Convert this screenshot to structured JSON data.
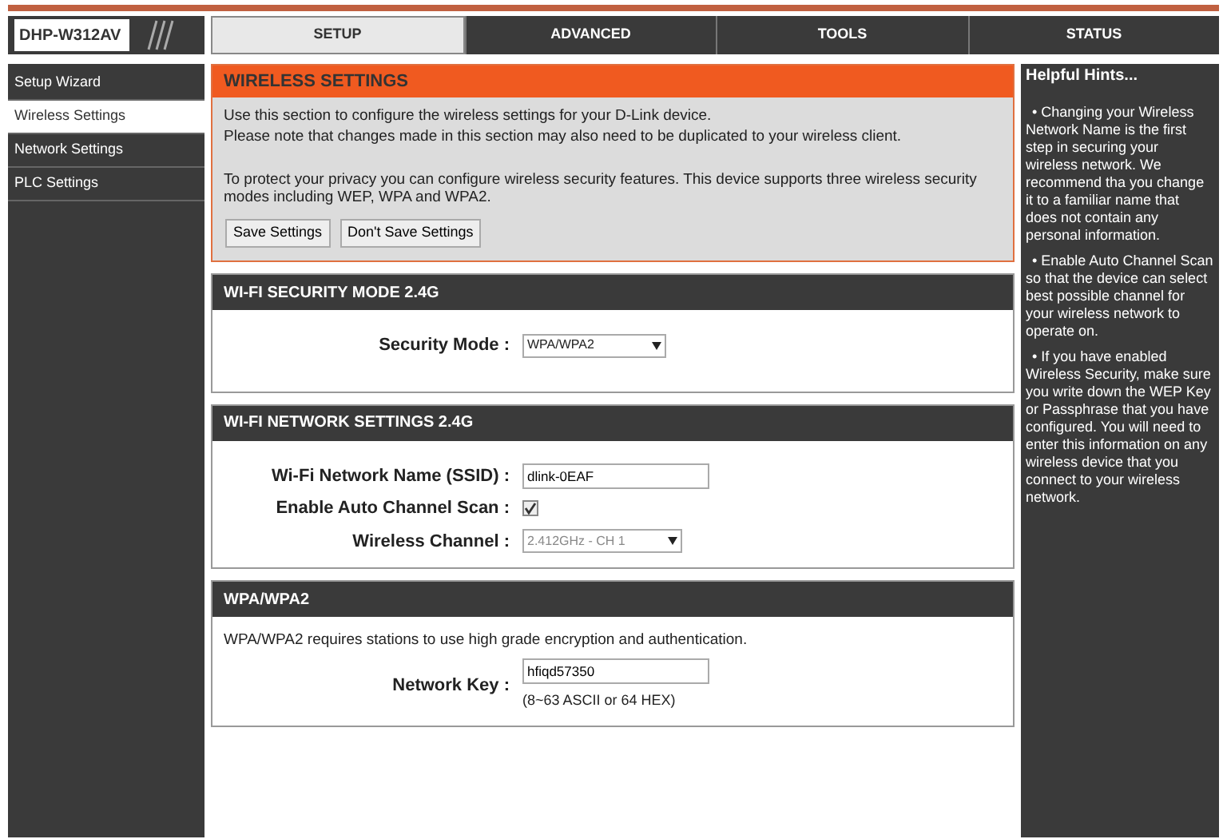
{
  "logo": "DHP-W312AV",
  "tabs": [
    {
      "label": "SETUP",
      "selected": true
    },
    {
      "label": "ADVANCED",
      "selected": false
    },
    {
      "label": "TOOLS",
      "selected": false
    },
    {
      "label": "STATUS",
      "selected": false
    }
  ],
  "sidebar": {
    "items": [
      {
        "label": "Setup Wizard",
        "selected": false
      },
      {
        "label": "Wireless Settings",
        "selected": true
      },
      {
        "label": "Network Settings",
        "selected": false
      },
      {
        "label": "PLC Settings",
        "selected": false
      }
    ]
  },
  "intro": {
    "title": "WIRELESS SETTINGS",
    "paragraphs": [
      "Use this section to configure the wireless settings for your D-Link device.",
      "Please note that changes made in this section may also need to be duplicated to your wireless client.",
      "To protect your privacy you can configure wireless security features. This device supports three wireless security modes including WEP, WPA and WPA2."
    ],
    "buttons": [
      "Save Settings",
      "Don't Save Settings"
    ]
  },
  "sections": [
    {
      "title": "WI-FI SECURITY MODE 2.4G",
      "rows": [
        {
          "kind": "select",
          "label": "Security Mode :",
          "value": "WPA/WPA2",
          "disabled": false
        }
      ]
    },
    {
      "title": "WI-FI NETWORK SETTINGS 2.4G",
      "rows": [
        {
          "kind": "text",
          "label": "Wi-Fi Network Name (SSID) :",
          "value": "dlink-0EAF"
        },
        {
          "kind": "checkbox",
          "label": "Enable Auto Channel Scan :",
          "checked": true
        },
        {
          "kind": "select",
          "label": "Wireless Channel :",
          "value": "2.412GHz - CH 1",
          "disabled": true
        }
      ]
    },
    {
      "title": "WPA/WPA2",
      "description": "WPA/WPA2 requires stations to use high grade encryption and authentication.",
      "rows": [
        {
          "kind": "text",
          "label": "Network Key :",
          "value": "hfiqd57350",
          "note": "(8~63 ASCII or 64 HEX)"
        }
      ]
    }
  ],
  "hints": {
    "title": "Helpful Hints...",
    "items": [
      "• Changing your Wireless Network Name is the first step in securing your wireless network. We recommend tha you change it to a familiar name that does not contain any personal information.",
      "• Enable Auto Channel Scan so that the device can select best possible channel for your wireless network to operate on.",
      "• If you have enabled Wireless Security, make sure you write down the WEP Key or Passphrase that you have configured. You will need to enter this information on any wireless device that you connect to your wireless network."
    ]
  }
}
